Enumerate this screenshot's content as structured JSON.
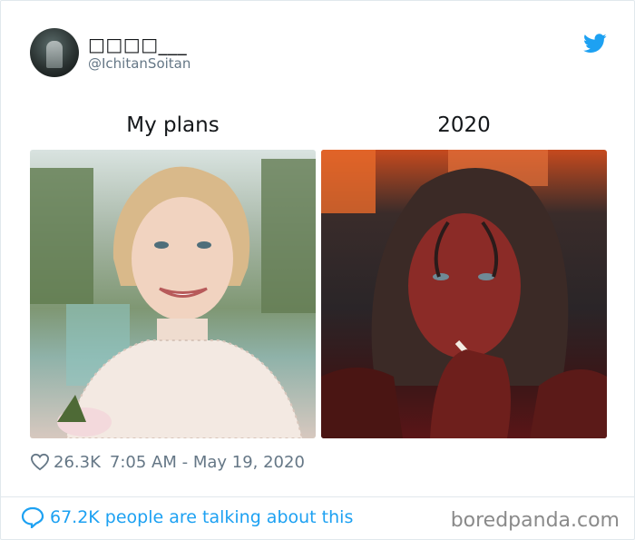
{
  "tweet": {
    "display_name": "□□□□___",
    "handle": "@IchitanSoitan",
    "columns": [
      {
        "label": "My plans"
      },
      {
        "label": "2020"
      }
    ],
    "likes": "26.3K",
    "timestamp": "7:05 AM - May 19, 2020"
  },
  "footer": {
    "talking_text": "67.2K people are talking about this",
    "brand": "boredpanda.com"
  },
  "colors": {
    "twitter_blue": "#1da1f2",
    "meta_gray": "#657786"
  },
  "icons": [
    "twitter-bird-icon",
    "heart-icon",
    "speech-bubble-icon"
  ]
}
